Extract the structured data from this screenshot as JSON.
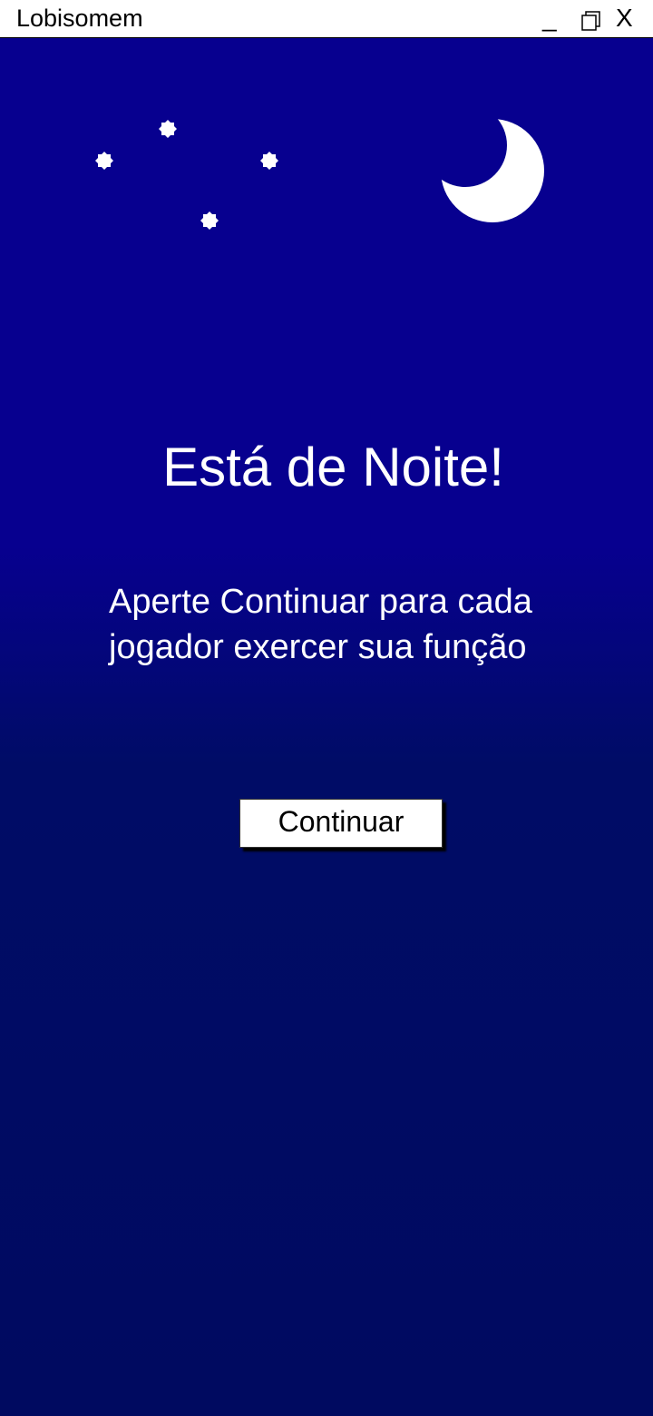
{
  "window": {
    "title": "Lobisomem",
    "minimize_label": "_",
    "close_label": "X"
  },
  "main": {
    "heading": "Está de Noite!",
    "message_line1": "Aperte Continuar para cada",
    "message_line2": "jogador exercer sua função",
    "continue_label": "Continuar"
  },
  "colors": {
    "sky_top": "#07008f",
    "sky_bottom": "#000a60",
    "moon": "#ffffff"
  }
}
